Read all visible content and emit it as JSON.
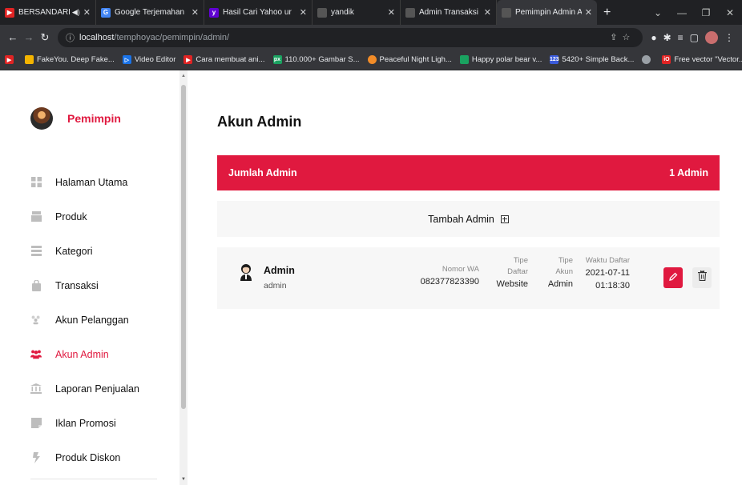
{
  "browser": {
    "tabs": [
      {
        "title": "BERSANDARLA",
        "favicon_color": "#e02424",
        "audio": true
      },
      {
        "title": "Google Terjemahan",
        "favicon_color": "#4285f4"
      },
      {
        "title": "Hasil Cari Yahoo ur",
        "favicon_color": "#6001d2"
      },
      {
        "title": "yandik",
        "favicon_color": "#666666"
      },
      {
        "title": "Admin Transaksi",
        "favicon_color": "#666666"
      },
      {
        "title": "Pemimpin Admin A",
        "favicon_color": "#666666",
        "active": true
      }
    ],
    "address": {
      "host": "localhost",
      "path": "/temphoyac/pemimpin/admin/"
    },
    "bookmarks": [
      {
        "label": "FakeYou. Deep Fake...",
        "color": "#f4b400"
      },
      {
        "label": "Video Editor",
        "color": "#1a73e8"
      },
      {
        "label": "Cara membuat ani...",
        "color": "#e02424"
      },
      {
        "label": "110.000+ Gambar S...",
        "color": "#1aa260"
      },
      {
        "label": "Peaceful Night Ligh...",
        "color": "#f28c28"
      },
      {
        "label": "Happy polar bear v...",
        "color": "#1aa260"
      },
      {
        "label": "5420+ Simple Back...",
        "color": "#3b5bdb"
      },
      {
        "label": "",
        "color": "#9aa0a6"
      },
      {
        "label": "Free vector \"Vector...",
        "color": "#e02424"
      }
    ],
    "bookmarks_more": "»"
  },
  "sidebar": {
    "brand": "Pemimpin",
    "items": [
      {
        "label": "Halaman Utama",
        "icon": "grid-icon"
      },
      {
        "label": "Produk",
        "icon": "box-icon"
      },
      {
        "label": "Kategori",
        "icon": "list-icon"
      },
      {
        "label": "Transaksi",
        "icon": "bag-icon"
      },
      {
        "label": "Akun Pelanggan",
        "icon": "users-icon"
      },
      {
        "label": "Akun Admin",
        "icon": "users-group-icon",
        "active": true
      },
      {
        "label": "Laporan Penjualan",
        "icon": "bank-icon"
      },
      {
        "label": "Iklan Promosi",
        "icon": "ad-icon"
      },
      {
        "label": "Produk Diskon",
        "icon": "bolt-icon"
      }
    ]
  },
  "main": {
    "title": "Akun Admin",
    "count_label": "Jumlah Admin",
    "count_value": "1 Admin",
    "add_label": "Tambah Admin",
    "admins": [
      {
        "name": "Admin",
        "username": "admin",
        "wa_label": "Nomor WA",
        "wa_value": "082377823390",
        "tipe_daftar_label_1": "Tipe",
        "tipe_daftar_label_2": "Daftar",
        "tipe_daftar_value": "Website",
        "tipe_akun_label_1": "Tipe",
        "tipe_akun_label_2": "Akun",
        "tipe_akun_value": "Admin",
        "waktu_label": "Waktu Daftar",
        "waktu_date": "2021-07-11",
        "waktu_time": "01:18:30"
      }
    ]
  },
  "colors": {
    "accent": "#e0193f",
    "card_bg": "#f7f7f7"
  }
}
